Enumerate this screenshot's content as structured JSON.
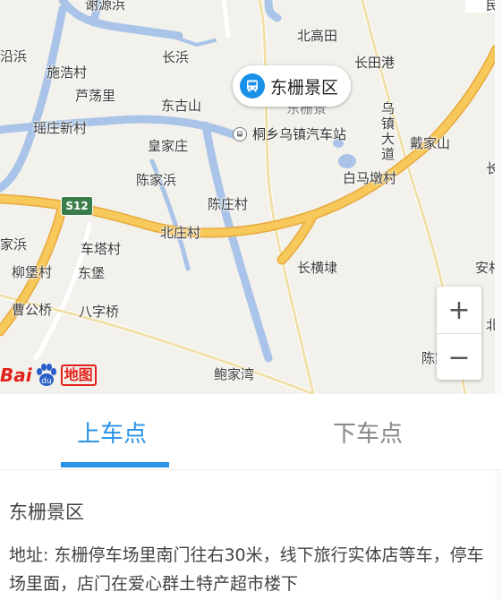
{
  "map": {
    "places": [
      {
        "id": "jiangyuanbang",
        "text": "谢源浜"
      },
      {
        "id": "beigaotian",
        "text": "北高田"
      },
      {
        "id": "changbang",
        "text": "长浜"
      },
      {
        "id": "changtiangang",
        "text": "长田港"
      },
      {
        "id": "yanbang",
        "text": "沿浜"
      },
      {
        "id": "shihaocun",
        "text": "施浩村"
      },
      {
        "id": "ludangli",
        "text": "芦荡里"
      },
      {
        "id": "dongshanshan",
        "text": "东古山"
      },
      {
        "id": "dongzhajing",
        "text": "东栅景"
      },
      {
        "id": "yaozhuangxincun",
        "text": "瑶庄新村"
      },
      {
        "id": "huangjiazhuang",
        "text": "皇家庄"
      },
      {
        "id": "daijiashan",
        "text": "戴家山"
      },
      {
        "id": "chenjiabang",
        "text": "陈家浜"
      },
      {
        "id": "baimadun",
        "text": "白马墩村"
      },
      {
        "id": "wuzhendadao",
        "text": "乌镇大道"
      },
      {
        "id": "chenzhuangcun",
        "text": "陈庄村"
      },
      {
        "id": "beizhuangcun",
        "text": "北庄村"
      },
      {
        "id": "jiabang",
        "text": "家浜"
      },
      {
        "id": "chetacun",
        "text": "车塔村"
      },
      {
        "id": "liubaocun",
        "text": "柳堡村"
      },
      {
        "id": "dongbao",
        "text": "东堡"
      },
      {
        "id": "changhengtai",
        "text": "长横埭"
      },
      {
        "id": "anxin",
        "text": "安村"
      },
      {
        "id": "caogongqiao",
        "text": "曹公桥"
      },
      {
        "id": "bazigiao",
        "text": "八字桥"
      },
      {
        "id": "chenjia2",
        "text": "陈家"
      },
      {
        "id": "baojiawan",
        "text": "鲍家湾"
      },
      {
        "id": "bei_edge",
        "text": "北"
      },
      {
        "id": "chang_edge",
        "text": "长"
      }
    ],
    "poi_label": "东栅景区",
    "station_label": "桐乡乌镇汽车站",
    "highway_shield": "S12",
    "zoom_in": "+",
    "zoom_out": "−",
    "logo_bai": "Bai",
    "logo_map": "地图",
    "top_right_fragment": "民"
  },
  "tabs": {
    "pickup": "上车点",
    "dropoff": "下车点"
  },
  "detail": {
    "name": "东栅景区",
    "address": "地址: 东栅停车场里南门往右30米，线下旅行实体店等车，停车场里面，店门在爱心群土特产超市楼下"
  },
  "colors": {
    "accent": "#2a93e8",
    "highway": "#f7c85a",
    "water": "#a9c4e8",
    "map_bg": "#f3f1ec"
  }
}
